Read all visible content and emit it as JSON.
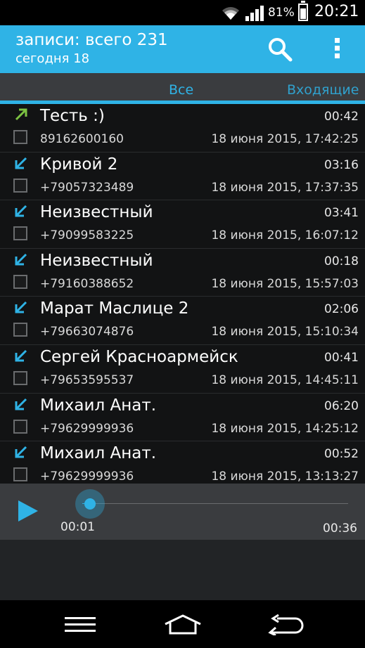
{
  "status_bar": {
    "battery_percent": "81%",
    "battery_level": 0.81,
    "time": "20:21",
    "icons": [
      "wifi-icon",
      "signal-icon",
      "battery-icon"
    ]
  },
  "action_bar": {
    "title": "записи: всего 231",
    "subtitle": "сегодня 18",
    "icons": [
      "search-icon",
      "overflow-menu-icon"
    ]
  },
  "tabs": [
    {
      "label": "Все",
      "selected": true
    },
    {
      "label": "Входящие",
      "selected": false
    }
  ],
  "calls": [
    {
      "direction": "outgoing",
      "name": "Тесть :)",
      "duration": "00:42",
      "number": "89162600160",
      "date": "18 июня 2015, 17:42:25"
    },
    {
      "direction": "incoming",
      "name": "Кривой 2",
      "duration": "03:16",
      "number": "+79057323489",
      "date": "18 июня 2015, 17:37:35"
    },
    {
      "direction": "incoming",
      "name": "Неизвестный",
      "duration": "03:41",
      "number": "+79099583225",
      "date": "18 июня 2015, 16:07:12"
    },
    {
      "direction": "incoming",
      "name": "Неизвестный",
      "duration": "00:18",
      "number": "+79160388652",
      "date": "18 июня 2015, 15:57:03"
    },
    {
      "direction": "incoming",
      "name": "Марат Маслице 2",
      "duration": "02:06",
      "number": "+79663074876",
      "date": "18 июня 2015, 15:10:34"
    },
    {
      "direction": "incoming",
      "name": "Сергей Красноармейск",
      "duration": "00:41",
      "number": "+79653595537",
      "date": "18 июня 2015, 14:45:11"
    },
    {
      "direction": "incoming",
      "name": "Михаил Анат.",
      "duration": "06:20",
      "number": "+79629999936",
      "date": "18 июня 2015, 14:25:12"
    },
    {
      "direction": "incoming",
      "name": "Михаил Анат.",
      "duration": "00:52",
      "number": "+79629999936",
      "date": "18 июня 2015, 13:13:27"
    }
  ],
  "player": {
    "current_time": "00:01",
    "total_time": "00:36",
    "progress": 0.03
  },
  "colors": {
    "accent": "#2fb3e6",
    "outgoing_arrow": "#7cc242",
    "incoming_arrow": "#2fb3e6"
  },
  "nav_bar": {
    "icons": [
      "menu-icon",
      "home-icon",
      "back-icon"
    ]
  }
}
